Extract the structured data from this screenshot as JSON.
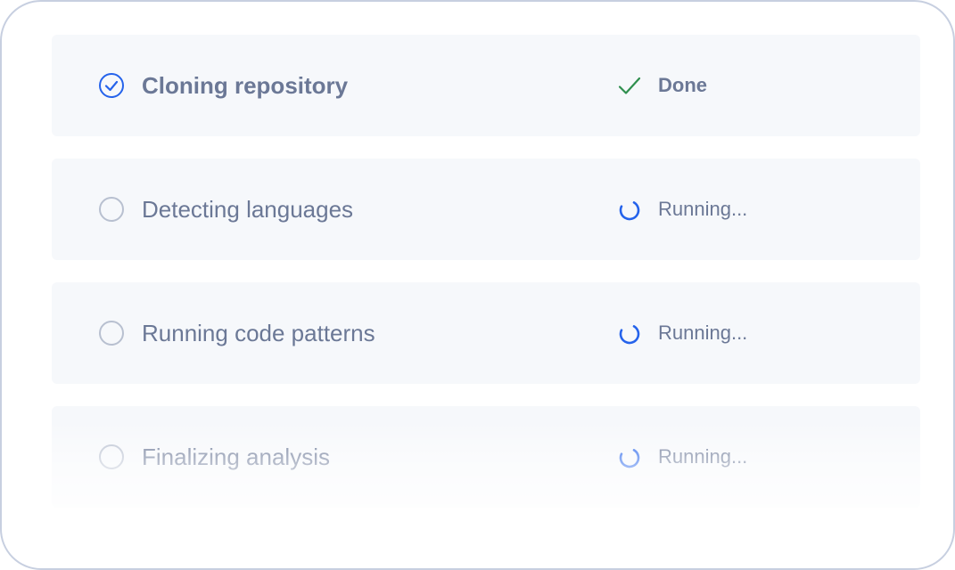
{
  "tasks": [
    {
      "label": "Cloning repository",
      "status": "Done",
      "state": "done",
      "check_icon": "check-circle-icon",
      "status_icon": "checkmark-icon"
    },
    {
      "label": "Detecting languages",
      "status": "Running...",
      "state": "running",
      "check_icon": "empty-circle-icon",
      "status_icon": "spinner-icon"
    },
    {
      "label": "Running code patterns",
      "status": "Running...",
      "state": "running",
      "check_icon": "empty-circle-icon",
      "status_icon": "spinner-icon"
    },
    {
      "label": "Finalizing analysis",
      "status": "Running...",
      "state": "running",
      "check_icon": "empty-circle-icon",
      "status_icon": "spinner-icon"
    }
  ],
  "colors": {
    "accent": "#2563eb",
    "done_check": "#2f8f4e",
    "text": "#6b7896",
    "row_bg": "#f6f8fb",
    "circle_border": "#b8c0d0"
  }
}
